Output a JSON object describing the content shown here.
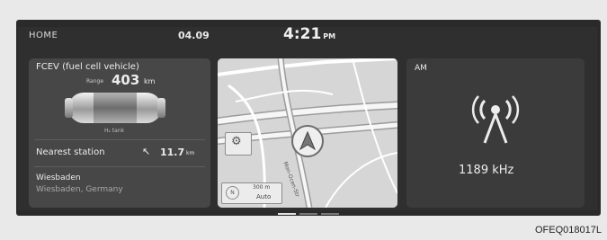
{
  "status_bar": {
    "home": "HOME",
    "date": "04.09",
    "time": "4:21",
    "ampm": "PM"
  },
  "fcev": {
    "title": "FCEV (fuel cell vehicle)",
    "range_label": "Range",
    "range_value": "403",
    "range_unit": "km",
    "tank_label": "H₂ tank",
    "nearest_label": "Nearest station",
    "nearest_distance": "11.7",
    "nearest_unit": "km",
    "station_city": "Wiesbaden",
    "station_address": "Wiesbaden, Germany"
  },
  "map": {
    "road_label": "Mon-Ocen-Str",
    "scale": "300 m",
    "view_mode": "Auto",
    "compass_label": "N"
  },
  "radio": {
    "band": "AM",
    "frequency": "1189 kHz",
    "icon": "broadcast-antenna-icon"
  },
  "footer": {
    "figure_code": "OFEQ018017L"
  }
}
